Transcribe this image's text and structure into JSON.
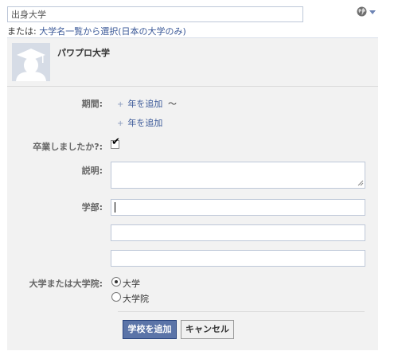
{
  "search": {
    "placeholder": "出身大学"
  },
  "or_line": {
    "prefix": "または: ",
    "link": "大学名一覧から選択(日本の大学のみ)"
  },
  "school": {
    "name": "パワプロ大学"
  },
  "period": {
    "label": "期間:",
    "add_year_start": "年を追加",
    "tilde": "〜",
    "add_year_end": "年を追加"
  },
  "graduated": {
    "label": "卒業しましたか?:",
    "checked": true
  },
  "description": {
    "label": "説明:",
    "value": ""
  },
  "faculty": {
    "label": "学部:",
    "values": [
      "",
      "",
      ""
    ]
  },
  "school_type": {
    "label": "大学または大学院:",
    "options": [
      "大学",
      "大学院"
    ],
    "selected": "大学"
  },
  "buttons": {
    "add": "学校を追加",
    "cancel": "キャンセル"
  },
  "colors": {
    "link": "#3b5998",
    "primary_button": "#5b74a8",
    "panel": "#f2f2f2"
  }
}
